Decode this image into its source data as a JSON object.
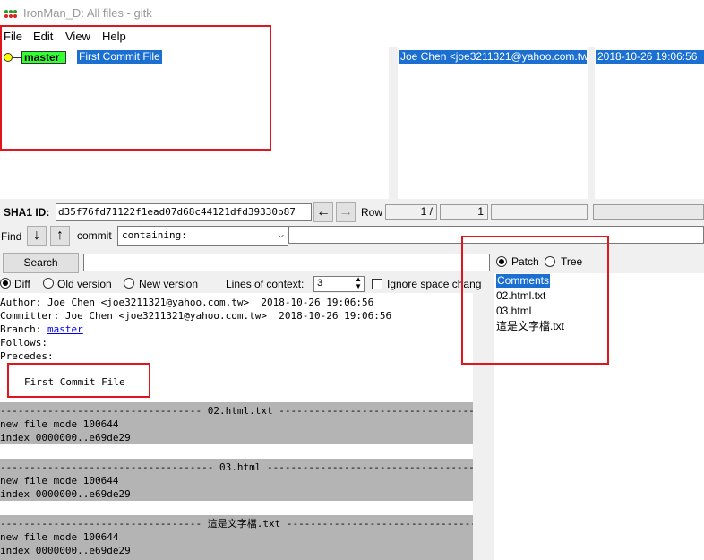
{
  "window": {
    "title": "IronMan_D: All files - gitk"
  },
  "menu": [
    "File",
    "Edit",
    "View",
    "Help"
  ],
  "commit_list": {
    "branch_label": "master",
    "subject": "First Commit File",
    "author": "Joe Chen <joe3211321@yahoo.com.tw>",
    "date": "2018-10-26 19:06:56"
  },
  "sha": {
    "label": "SHA1 ID:",
    "value": "d35f76fd71122f1ead07d68c44121dfd39330b87",
    "row_label": "Row",
    "row_current": "1 /",
    "row_total": "1"
  },
  "find": {
    "label": "Find",
    "commit_label": "commit",
    "mode": "containing:"
  },
  "search": {
    "button": "Search"
  },
  "options": {
    "diff": "Diff",
    "old_version": "Old version",
    "new_version": "New version",
    "context_label": "Lines of context:",
    "context_value": "3",
    "ignore_space": "Ignore space chang"
  },
  "view_mode": {
    "patch": "Patch",
    "tree": "Tree"
  },
  "diff": {
    "author": "Author: Joe Chen <joe3211321@yahoo.com.tw>  2018-10-26 19:06:56",
    "committer": "Committer: Joe Chen <joe3211321@yahoo.com.tw>  2018-10-26 19:06:56",
    "branch_prefix": "Branch: ",
    "branch": "master",
    "follows": "Follows:",
    "precedes": "Precedes:",
    "message": "First Commit File",
    "files": [
      {
        "header": "---------------------------------- 02.html.txt ----------------------------------",
        "mode": "new file mode 100644",
        "index": "index 0000000..e69de29"
      },
      {
        "header": "------------------------------------ 03.html ------------------------------------",
        "mode": "new file mode 100644",
        "index": "index 0000000..e69de29"
      },
      {
        "header": "---------------------------------- 這是文字檔.txt ----------------------------------",
        "mode": "new file mode 100644",
        "index": "index 0000000..e69de29"
      }
    ]
  },
  "file_list": [
    "Comments",
    "02.html.txt",
    "03.html",
    "這是文字檔.txt"
  ],
  "colors": {
    "selection": "#1a6fd0",
    "branch_tag": "#33ff33",
    "annotation": "#e0161c",
    "diff_header_bg": "#b4b4b4"
  }
}
